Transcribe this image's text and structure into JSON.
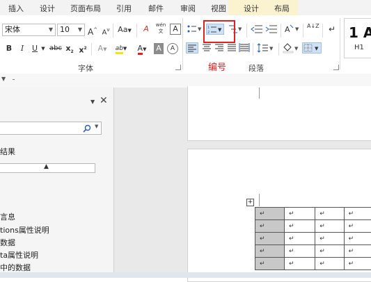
{
  "menu": {
    "tabs": [
      "插入",
      "设计",
      "页面布局",
      "引用",
      "邮件",
      "审阅",
      "视图",
      "设计",
      "布局"
    ]
  },
  "font": {
    "name": "宋体",
    "size": "10",
    "grow_label": "A",
    "shrink_label": "A",
    "case_label": "Aa",
    "bold": "B",
    "italic": "I",
    "underline": "U",
    "strike": "abc",
    "subscript": "x",
    "superscript": "x",
    "text_effect": "A",
    "highlight": "ab",
    "color": "A",
    "shading": "A",
    "clear_format": "A",
    "phonetic": "wén",
    "phonetic_sub": "文",
    "border_char": "A"
  },
  "paragraph": {
    "sort_label": "A↓Z"
  },
  "groups": {
    "font": "字体",
    "numbering_annotation": "编号",
    "paragraph": "段落"
  },
  "styles": {
    "preview": "1 A",
    "caption": "H1"
  },
  "nav": {
    "search_icon": "search-icon",
    "items": [
      "结果",
      "言息",
      "tions属性说明",
      "数据",
      "ta属性说明",
      "中的数据"
    ]
  },
  "table": {
    "mark": "↵",
    "rows": 5,
    "cols": 4
  },
  "colors": {
    "annotation_red": "#e0201e",
    "ribbon_selected": "#cfe2f5",
    "context_tab_band": "#fbf3d0"
  }
}
